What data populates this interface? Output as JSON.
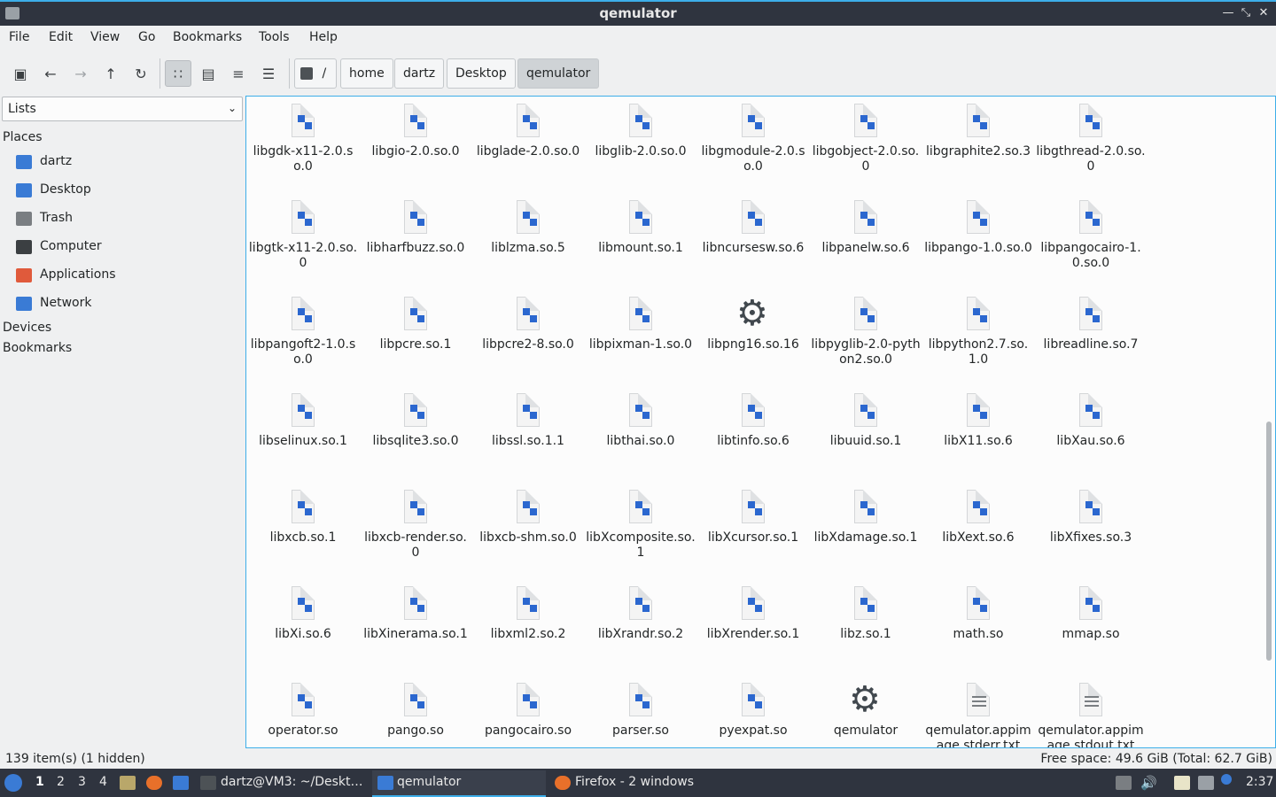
{
  "window": {
    "title": "qemulator"
  },
  "menu": [
    "File",
    "Edit",
    "View",
    "Go",
    "Bookmarks",
    "Tools",
    "Help"
  ],
  "path": {
    "root": "/",
    "crumbs": [
      "home",
      "dartz",
      "Desktop",
      "qemulator"
    ]
  },
  "sidebar": {
    "mode": "Lists",
    "places_label": "Places",
    "places": [
      {
        "label": "dartz",
        "icon": "home-folder-icon",
        "color": "#3a7bd5"
      },
      {
        "label": "Desktop",
        "icon": "desktop-icon",
        "color": "#3a7bd5"
      },
      {
        "label": "Trash",
        "icon": "trash-icon",
        "color": "#7a7e82"
      },
      {
        "label": "Computer",
        "icon": "computer-icon",
        "color": "#3b3f42"
      },
      {
        "label": "Applications",
        "icon": "applications-icon",
        "color": "#e05a3b"
      },
      {
        "label": "Network",
        "icon": "network-icon",
        "color": "#3a7bd5"
      }
    ],
    "devices_label": "Devices",
    "bookmarks_label": "Bookmarks"
  },
  "files": [
    [
      "libgdk-x11-2.0.so.0",
      "lib"
    ],
    [
      "libgio-2.0.so.0",
      "lib"
    ],
    [
      "libglade-2.0.so.0",
      "lib"
    ],
    [
      "libglib-2.0.so.0",
      "lib"
    ],
    [
      "libgmodule-2.0.so.0",
      "lib"
    ],
    [
      "libgobject-2.0.so.0",
      "lib"
    ],
    [
      "libgraphite2.so.3",
      "lib"
    ],
    [
      "libgthread-2.0.so.0",
      "lib"
    ],
    [
      "libgtk-x11-2.0.so.0",
      "lib"
    ],
    [
      "libharfbuzz.so.0",
      "lib"
    ],
    [
      "liblzma.so.5",
      "lib"
    ],
    [
      "libmount.so.1",
      "lib"
    ],
    [
      "libncursesw.so.6",
      "lib"
    ],
    [
      "libpanelw.so.6",
      "lib"
    ],
    [
      "libpango-1.0.so.0",
      "lib"
    ],
    [
      "libpangocairo-1.0.so.0",
      "lib"
    ],
    [
      "libpangoft2-1.0.so.0",
      "lib"
    ],
    [
      "libpcre.so.1",
      "lib"
    ],
    [
      "libpcre2-8.so.0",
      "lib"
    ],
    [
      "libpixman-1.so.0",
      "lib"
    ],
    [
      "libpng16.so.16",
      "gear"
    ],
    [
      "libpyglib-2.0-python2.so.0",
      "lib"
    ],
    [
      "libpython2.7.so.1.0",
      "lib"
    ],
    [
      "libreadline.so.7",
      "lib"
    ],
    [
      "libselinux.so.1",
      "lib"
    ],
    [
      "libsqlite3.so.0",
      "lib"
    ],
    [
      "libssl.so.1.1",
      "lib"
    ],
    [
      "libthai.so.0",
      "lib"
    ],
    [
      "libtinfo.so.6",
      "lib"
    ],
    [
      "libuuid.so.1",
      "lib"
    ],
    [
      "libX11.so.6",
      "lib"
    ],
    [
      "libXau.so.6",
      "lib"
    ],
    [
      "libxcb.so.1",
      "lib"
    ],
    [
      "libxcb-render.so.0",
      "lib"
    ],
    [
      "libxcb-shm.so.0",
      "lib"
    ],
    [
      "libXcomposite.so.1",
      "lib"
    ],
    [
      "libXcursor.so.1",
      "lib"
    ],
    [
      "libXdamage.so.1",
      "lib"
    ],
    [
      "libXext.so.6",
      "lib"
    ],
    [
      "libXfixes.so.3",
      "lib"
    ],
    [
      "libXi.so.6",
      "lib"
    ],
    [
      "libXinerama.so.1",
      "lib"
    ],
    [
      "libxml2.so.2",
      "lib"
    ],
    [
      "libXrandr.so.2",
      "lib"
    ],
    [
      "libXrender.so.1",
      "lib"
    ],
    [
      "libz.so.1",
      "lib"
    ],
    [
      "math.so",
      "lib"
    ],
    [
      "mmap.so",
      "lib"
    ],
    [
      "operator.so",
      "lib"
    ],
    [
      "pango.so",
      "lib"
    ],
    [
      "pangocairo.so",
      "lib"
    ],
    [
      "parser.so",
      "lib"
    ],
    [
      "pyexpat.so",
      "lib"
    ],
    [
      "qemulator",
      "gear"
    ],
    [
      "qemulator.appimage.stderr.txt",
      "text"
    ],
    [
      "qemulator.appimage.stdout.txt",
      "text"
    ]
  ],
  "status": {
    "items": "139 item(s) (1 hidden)",
    "free": "Free space: 49.6 GiB (Total: 62.7 GiB)"
  },
  "taskbar": {
    "workspaces": [
      "1",
      "2",
      "3",
      "4"
    ],
    "windows": [
      "dartz@VM3: ~/Deskt…",
      "qemulator",
      "Firefox - 2 windows"
    ],
    "clock": "2:37"
  }
}
